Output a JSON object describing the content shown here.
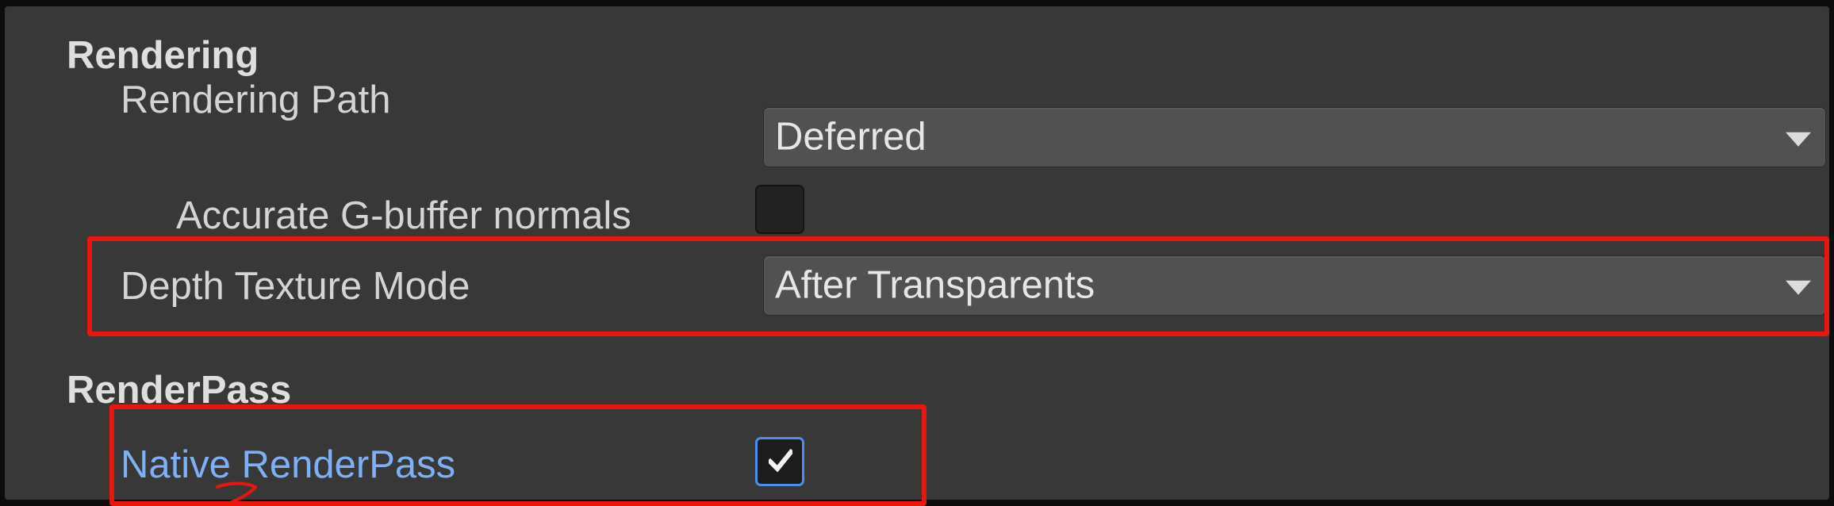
{
  "sections": {
    "rendering": {
      "title": "Rendering",
      "rendering_path": {
        "label": "Rendering Path",
        "value": "Deferred"
      },
      "accurate_gbuffer_normals": {
        "label": "Accurate G-buffer normals",
        "checked": false
      },
      "depth_texture_mode": {
        "label": "Depth Texture Mode",
        "value": "After Transparents"
      }
    },
    "renderpass": {
      "title": "RenderPass",
      "native_renderpass": {
        "label": "Native RenderPass",
        "checked": true
      }
    }
  },
  "colors": {
    "panel_background": "#383838",
    "dropdown_background": "#515151",
    "highlight": "#e8160c",
    "link_label": "#7fb0f5",
    "checkbox_accent": "#4e8de8"
  }
}
